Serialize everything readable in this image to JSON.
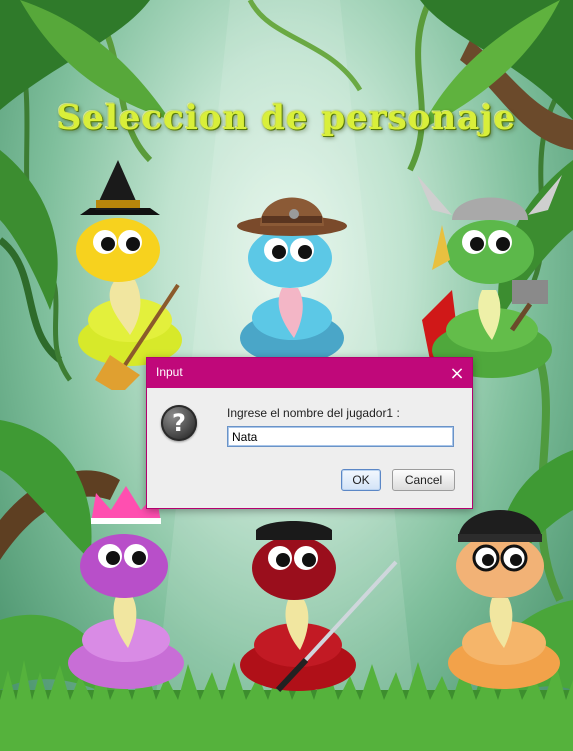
{
  "screen": {
    "title": "Seleccion de personaje"
  },
  "characters": [
    {
      "name": "witch-snake",
      "accessory": "witch-hat-and-broom",
      "color": "#f7d21e"
    },
    {
      "name": "cowboy-snake",
      "accessory": "cowboy-hat",
      "color": "#5cc8e6"
    },
    {
      "name": "thor-snake",
      "accessory": "winged-helmet-and-hammer",
      "color": "#5cb84a"
    },
    {
      "name": "princess-snake",
      "accessory": "pink-crown",
      "color": "#b84fc9"
    },
    {
      "name": "ninja-snake",
      "accessory": "bandana-and-katana",
      "color": "#9a0e1c"
    },
    {
      "name": "hipster-snake",
      "accessory": "beanie-and-glasses",
      "color": "#f2b276"
    }
  ],
  "dialog": {
    "title": "Input",
    "close_label": "×",
    "icon": "question-icon",
    "icon_glyph": "?",
    "prompt": "Ingrese el nombre del jugador1 :",
    "input_value": "Nata",
    "ok_label": "OK",
    "cancel_label": "Cancel",
    "accent": "#c0087a"
  }
}
